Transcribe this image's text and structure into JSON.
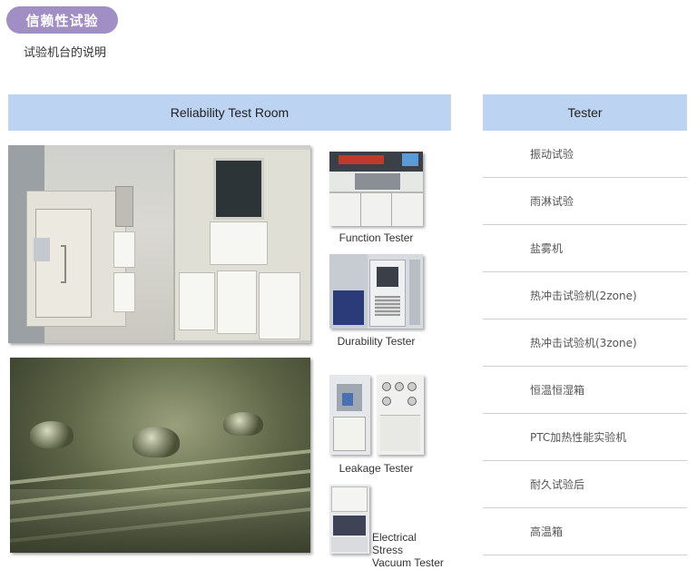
{
  "page": {
    "title": "信赖性试验",
    "subtitle": "试验机台的说明"
  },
  "room_section": {
    "header": "Reliability Test Room",
    "captions": {
      "function": "Function Tester",
      "durability": "Durability Tester",
      "leakage": "Leakage Tester",
      "electrical_line1": "Electrical Stress",
      "electrical_line2": "Vacuum Tester"
    }
  },
  "tester_section": {
    "header": "Tester",
    "items": [
      "振动试验",
      "雨淋试验",
      "盐雾机",
      "热冲击试验机(2zone)",
      "热冲击试验机(3zone)",
      "恒温恒湿箱",
      "PTC加热性能实验机",
      "耐久试验后",
      "高温箱"
    ]
  },
  "colors": {
    "title_pill": "#a08ec4",
    "header_bar": "#bcd3f1",
    "divider": "#cfcfcf"
  }
}
